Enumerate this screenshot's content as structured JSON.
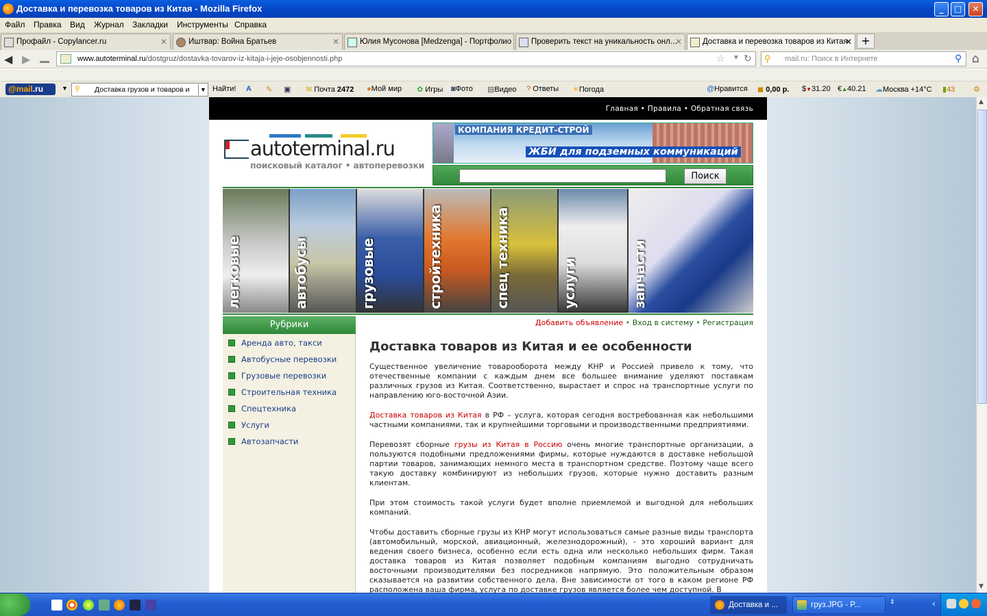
{
  "window": {
    "title": "Доставка и перевозка товаров из Китая - Mozilla Firefox"
  },
  "menu": [
    "Файл",
    "Правка",
    "Вид",
    "Журнал",
    "Закладки",
    "Инструменты",
    "Справка"
  ],
  "tabs": [
    {
      "label": "Профайл - Copylancer.ru"
    },
    {
      "label": "Иштвар: Война Братьев"
    },
    {
      "label": "Юлия Мусонова [Medzenga] - Портфолио"
    },
    {
      "label": "Проверить текст на уникальность онл..."
    },
    {
      "label": "Доставка и перевозка товаров из Китая"
    }
  ],
  "url": {
    "host": "www.autoterminal.ru",
    "path": "/dostgruz/dostavka-tovarov-iz-kitaja-i-jeje-osobjennosti.php"
  },
  "search": {
    "placeholder": "mail.ru: Поиск в Интернете"
  },
  "mailbar": {
    "logo_mail": "@mail",
    "logo_ru": ".ru",
    "search_value": "Доставка грузов и товаров и",
    "find": "Найти!",
    "mail": "Почта",
    "mail_count": "2472",
    "myworld": "Мой мир",
    "games": "Игры",
    "photo": "Фото",
    "video": "Видео",
    "answers": "Ответы",
    "weather": "Погода",
    "like": "Нравится",
    "money": "0,00 р.",
    "usd": "31.20",
    "eur": "40.21",
    "city": "Москва +14°C",
    "count": "43"
  },
  "site": {
    "topnav": "Главная • Правила • Обратная связь",
    "logo_word": "autoterminal.ru",
    "logo_sub": "поисковый каталог • автоперевозки",
    "banner_top": "КОМПАНИЯ КРЕДИТ-СТРОЙ",
    "banner_main": "ЖБИ для подземных коммуникаций",
    "search_button": "Поиск",
    "categories": [
      "легковые",
      "автобусы",
      "грузовые",
      "стройтехника",
      "спец техника",
      "услуги",
      "запчасти"
    ],
    "sidebar_title": "Рубрики",
    "sidebar": [
      "Аренда авто, такси",
      "Автобусные перевозки",
      "Грузовые перевозки",
      "Строительная техника",
      "Спецтехника",
      "Услуги",
      "Автозапчасти"
    ],
    "add_ad": "Добавить объявление",
    "login": "Вход в систему",
    "register": "Регистрация",
    "heading": "Доставка товаров из Китая и ее особенности",
    "p1": "Существенное увеличение товарооборота между КНР и Россией привело к тому, что отечественные компании с каждым днем все большее внимание уделяют поставкам различных грузов из Китая. Соответственно, вырастает и спрос на транспортные услуги по направлению юго-восточной Азии.",
    "p2_link": "Доставка товаров из Китая",
    "p2_rest": " в РФ – услуга, которая сегодня востребованная как небольшими частными компаниями, так и крупнейшими торговыми и производственными предприятиями.",
    "p3_a": "Перевозят сборные ",
    "p3_link": "грузы из Китая в Россию",
    "p3_b": " очень многие транспортные организации, а пользуются подобными предложениями фирмы, которые нуждаются в доставке небольшой партии товаров, занимающих немного места в транспортном средстве. Поэтому чаще всего такую доставку комбинируют из небольших грузов, которые нужно доставить разным клиентам.",
    "p4": "При этом стоимость такой услуги будет вполне приемлемой и выгодной для небольших компаний.",
    "p5": "Чтобы доставить сборные грузы из КНР могут использоваться самые разные виды транспорта (автомобильный, морской, авиационный, железнодорожный), - это хороший вариант для ведения своего бизнеса, особенно если есть одна или несколько небольших фирм. Такая доставка товаров из Китая позволяет подобным компаниям выгодно сотрудничать восточными производителями без посредников напрямую. Это положительным образом сказывается на развитии собственного дела. Вне зависимости от того в каком регионе РФ расположена ваша фирма, услуга по доставке грузов является более чем доступной. В"
  },
  "taskbar": {
    "task1": "Доставка и ...",
    "task2": "груз.JPG - P..."
  }
}
